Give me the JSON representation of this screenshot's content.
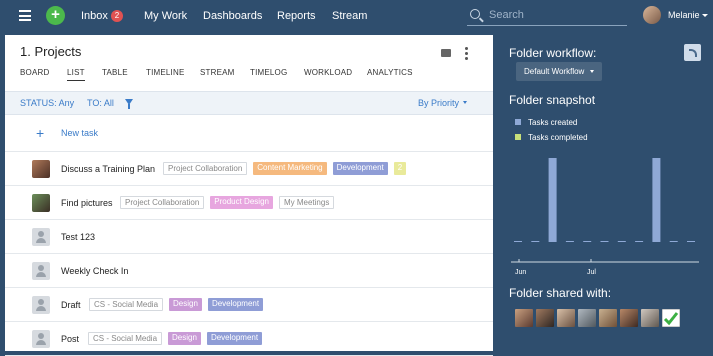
{
  "topbar": {
    "inbox_label": "Inbox",
    "inbox_count": "2",
    "my_work": "My Work",
    "dashboards": "Dashboards",
    "reports": "Reports",
    "stream": "Stream",
    "search_placeholder": "Search",
    "user_name": "Melanie"
  },
  "main": {
    "title": "1. Projects",
    "tabs": [
      "BOARD",
      "LIST",
      "TABLE",
      "TIMELINE",
      "STREAM",
      "TIMELOG",
      "WORKLOAD",
      "ANALYTICS"
    ],
    "active_tab": "LIST",
    "filters": {
      "status": "STATUS: Any",
      "to": "TO: All",
      "sort": "By Priority"
    },
    "new_task": "New task",
    "tasks": [
      {
        "name": "Discuss a Training Plan",
        "tags": [
          {
            "text": "Project Collaboration",
            "style": "outline"
          },
          {
            "text": "Content Marketing",
            "style": "orange"
          },
          {
            "text": "Development",
            "style": "purple"
          },
          {
            "text": "2",
            "style": "yellow"
          }
        ]
      },
      {
        "name": "Find pictures",
        "tags": [
          {
            "text": "Project Collaboration",
            "style": "outline"
          },
          {
            "text": "Product Design",
            "style": "pink"
          },
          {
            "text": "My Meetings",
            "style": "outline"
          }
        ]
      },
      {
        "name": "Test 123",
        "tags": []
      },
      {
        "name": "Weekly Check In",
        "tags": []
      },
      {
        "name": "Draft",
        "tags": [
          {
            "text": "CS - Social Media",
            "style": "outline"
          },
          {
            "text": "Design",
            "style": "mauve"
          },
          {
            "text": "Development",
            "style": "purple"
          }
        ]
      },
      {
        "name": "Post",
        "tags": [
          {
            "text": "CS - Social Media",
            "style": "outline"
          },
          {
            "text": "Design",
            "style": "mauve"
          },
          {
            "text": "Development",
            "style": "purple"
          }
        ]
      }
    ]
  },
  "side": {
    "workflow_heading": "Folder workflow:",
    "workflow_value": "Default Workflow",
    "snapshot_heading": "Folder snapshot",
    "shared_heading": "Folder shared with:",
    "shared_more": "+",
    "colors": {
      "created": "#8fa9d6",
      "completed": "#c8e07a"
    }
  },
  "chart_data": {
    "type": "bar",
    "series": [
      {
        "name": "Tasks created",
        "values": [
          0,
          0,
          1,
          0,
          0,
          0,
          0,
          0,
          1,
          0,
          0
        ]
      },
      {
        "name": "Tasks completed",
        "values": [
          0,
          0,
          0,
          0,
          0,
          0,
          0,
          0,
          0,
          0,
          0
        ]
      }
    ],
    "x_tick_labels": [
      "Jun",
      "Jul"
    ],
    "ylim": [
      0,
      1
    ],
    "legend": "top-left",
    "grid": false
  }
}
